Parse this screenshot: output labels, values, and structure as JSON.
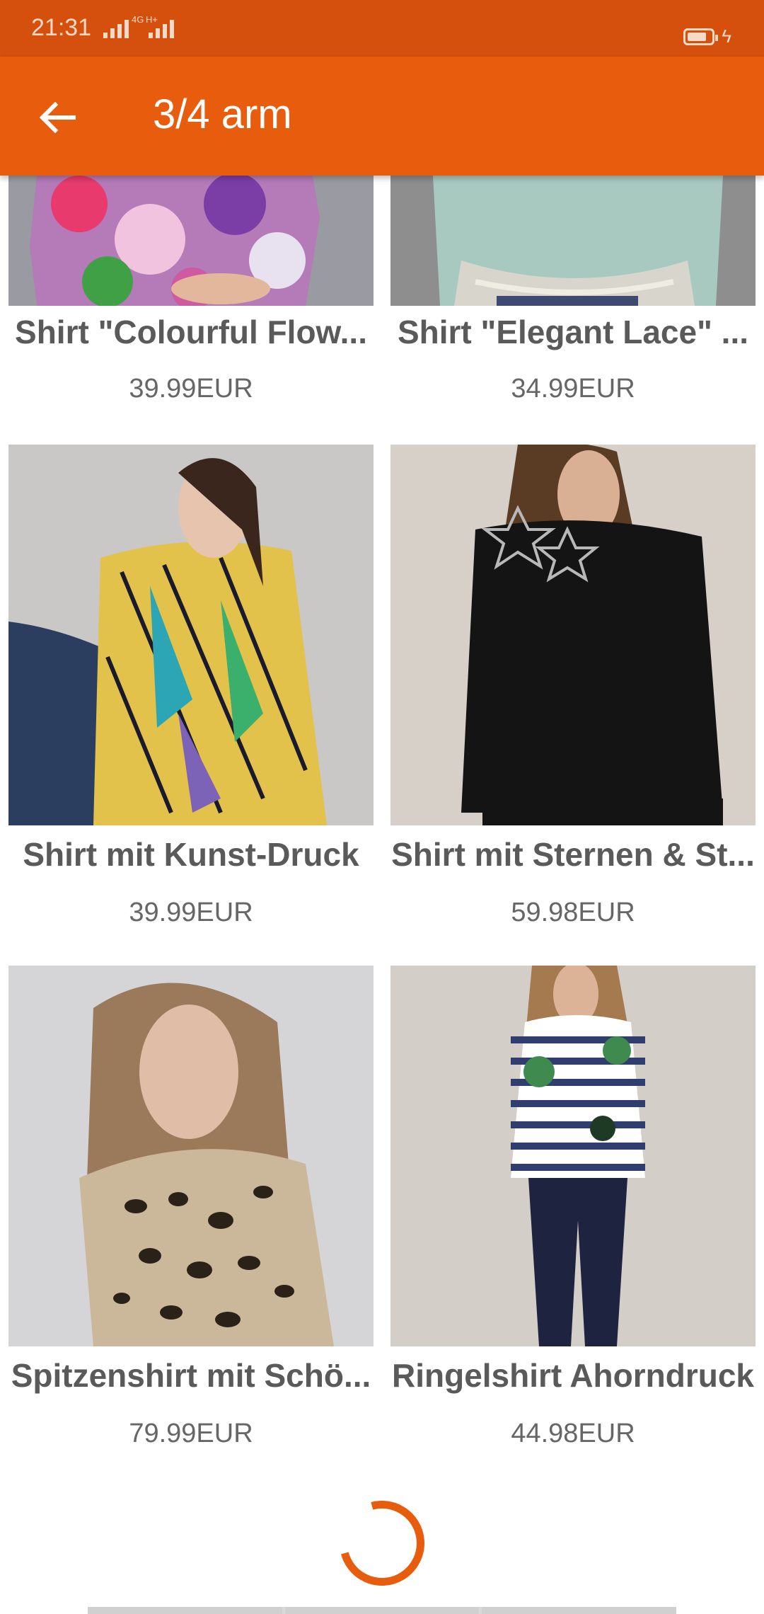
{
  "status_bar": {
    "time": "21:31",
    "net1": "4G",
    "net2": "H+"
  },
  "app_bar": {
    "title": "3/4 arm"
  },
  "products": [
    {
      "name": "Shirt \"Colourful Flow...",
      "price": "39.99EUR",
      "image": "floral-purple-shirt"
    },
    {
      "name": "Shirt \"Elegant Lace\" ...",
      "price": "34.99EUR",
      "image": "mint-lace-shirt"
    },
    {
      "name": "Shirt mit Kunst-Druck",
      "price": "39.99EUR",
      "image": "colorful-art-print-shirt"
    },
    {
      "name": "Shirt mit Sternen & St...",
      "price": "59.98EUR",
      "image": "black-star-shirt"
    },
    {
      "name": "Spitzenshirt mit Schö...",
      "price": "79.99EUR",
      "image": "leopard-print-shirt"
    },
    {
      "name": "Ringelshirt Ahorndruck",
      "price": "44.98EUR",
      "image": "striped-maple-shirt"
    }
  ],
  "colors": {
    "accent": "#e85c0d",
    "status_bar": "#d6500d"
  }
}
